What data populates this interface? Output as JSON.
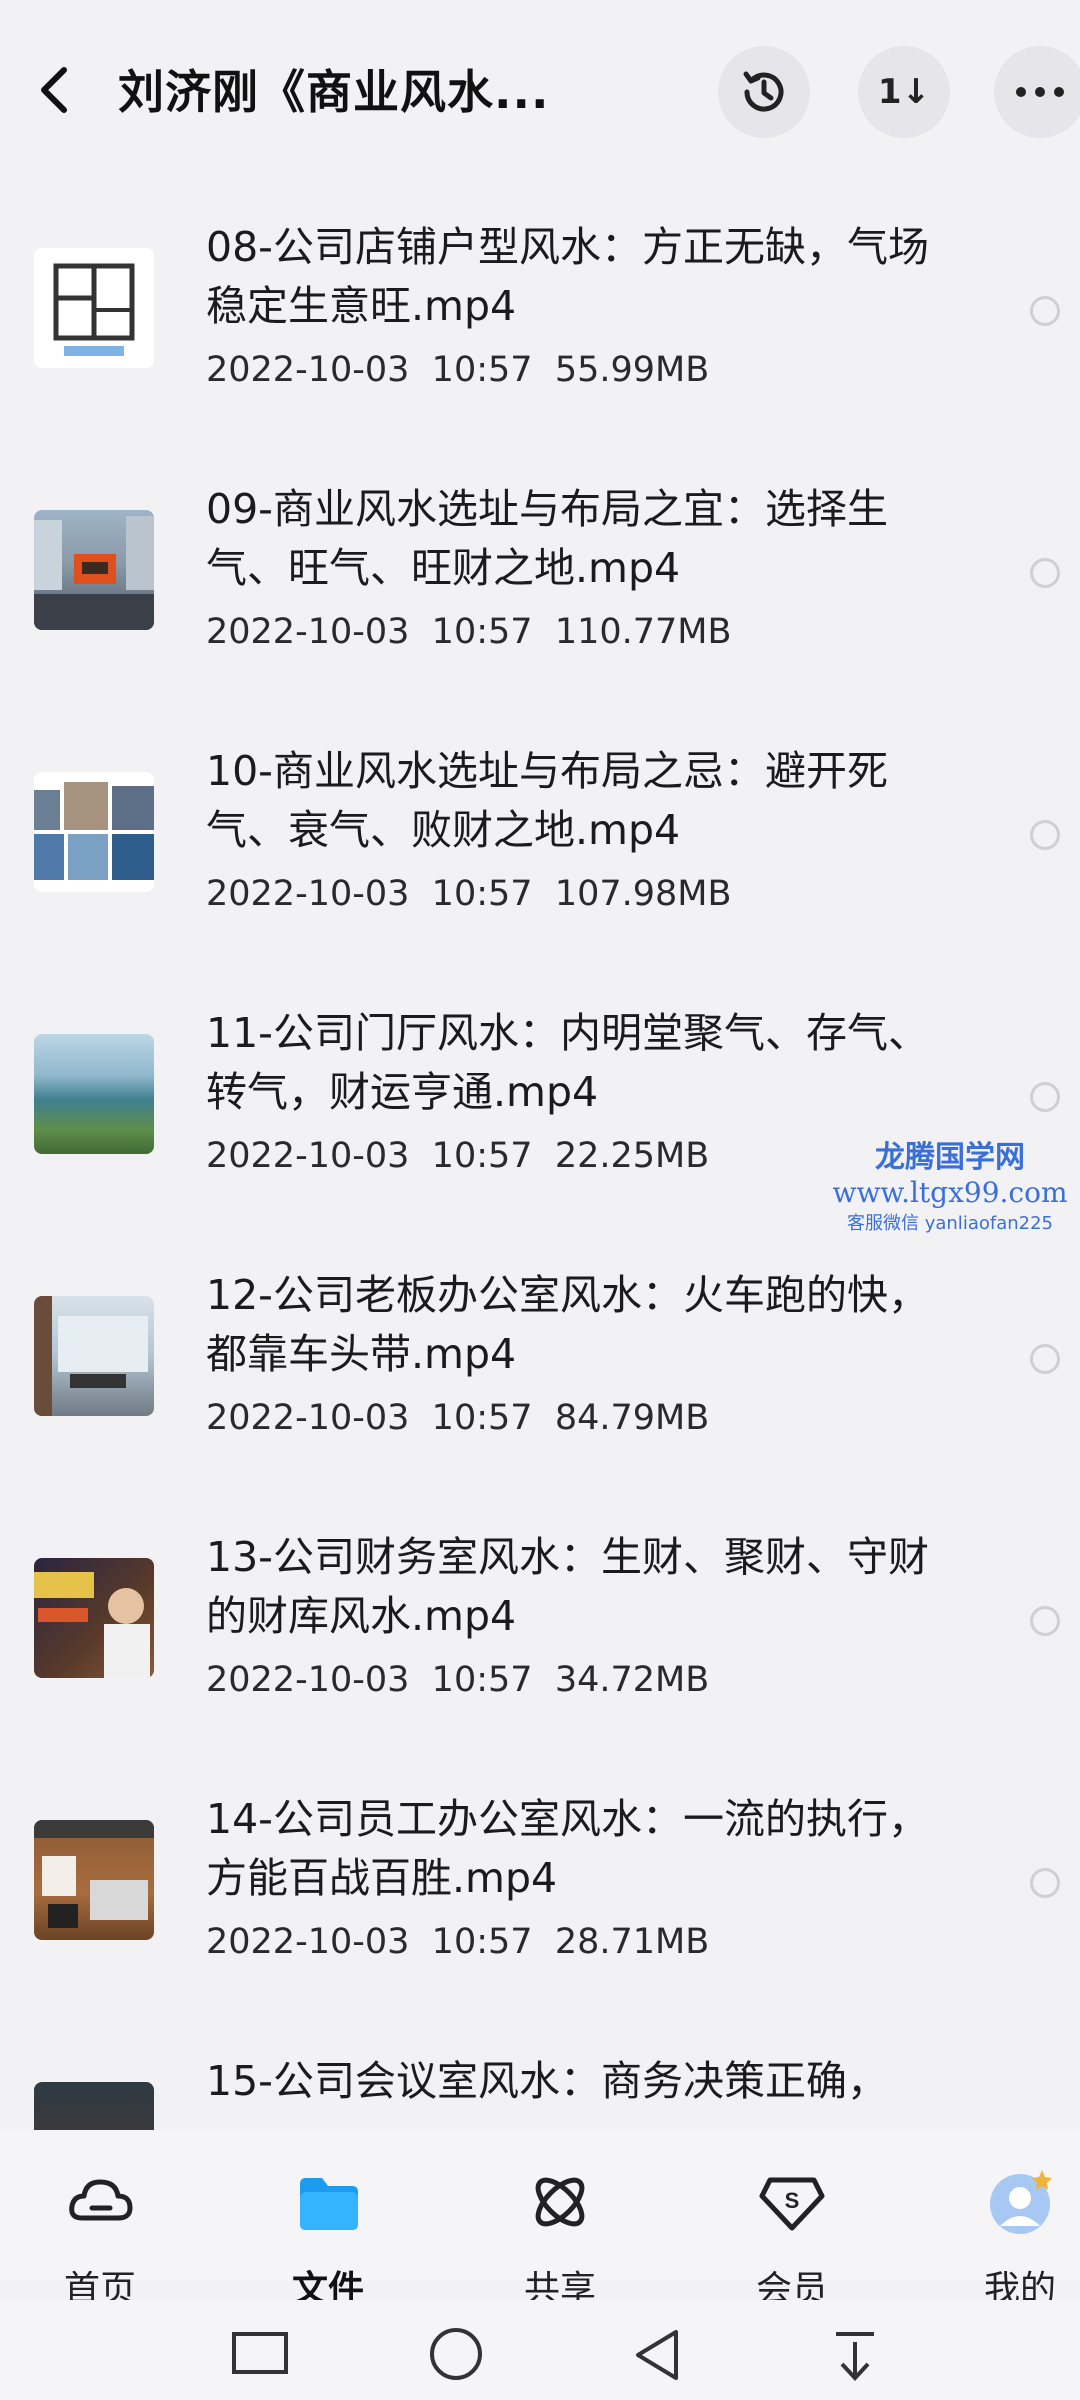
{
  "header": {
    "title": "刘济刚《商业风水...",
    "sort_label": "1↓"
  },
  "files": [
    {
      "name": "08-公司店铺户型风水：方正无缺，气场稳定生意旺.mp4",
      "date": "2022-10-03",
      "time": "10:57",
      "size": "55.99MB",
      "thumb": "floorplan"
    },
    {
      "name": "09-商业风水选址与布局之宜：选择生气、旺气、旺财之地.mp4",
      "date": "2022-10-03",
      "time": "10:57",
      "size": "110.77MB",
      "thumb": "street"
    },
    {
      "name": "10-商业风水选址与布局之忌：避开死气、衰气、败财之地.mp4",
      "date": "2022-10-03",
      "time": "10:57",
      "size": "107.98MB",
      "thumb": "collage"
    },
    {
      "name": "11-公司门厅风水：内明堂聚气、存气、转气，财运亨通.mp4",
      "date": "2022-10-03",
      "time": "10:57",
      "size": "22.25MB",
      "thumb": "landscape"
    },
    {
      "name": "12-公司老板办公室风水：火车跑的快，都靠车头带.mp4",
      "date": "2022-10-03",
      "time": "10:57",
      "size": "84.79MB",
      "thumb": "office"
    },
    {
      "name": "13-公司财务室风水：生财、聚财、守财的财库风水.mp4",
      "date": "2022-10-03",
      "time": "10:57",
      "size": "34.72MB",
      "thumb": "lecture"
    },
    {
      "name": "14-公司员工办公室风水：一流的执行，方能百战百胜.mp4",
      "date": "2022-10-03",
      "time": "10:57",
      "size": "28.71MB",
      "thumb": "desk"
    },
    {
      "name": "15-公司会议室风水：商务决策正确，",
      "date": "",
      "time": "",
      "size": "",
      "thumb": "meeting"
    }
  ],
  "watermark": {
    "line1": "龙腾国学网",
    "line2": "www.ltgx99.com",
    "line3": "客服微信 yanliaofan225"
  },
  "tabs": [
    {
      "label": "首页",
      "icon": "cloud-home-icon"
    },
    {
      "label": "文件",
      "icon": "folder-icon"
    },
    {
      "label": "共享",
      "icon": "share-orbit-icon"
    },
    {
      "label": "会员",
      "icon": "vip-diamond-icon"
    },
    {
      "label": "我的",
      "icon": "avatar-icon"
    }
  ],
  "colors": {
    "accent": "#1d9bf0",
    "background": "#f2f2f4",
    "watermark": "#3a6fd8"
  }
}
